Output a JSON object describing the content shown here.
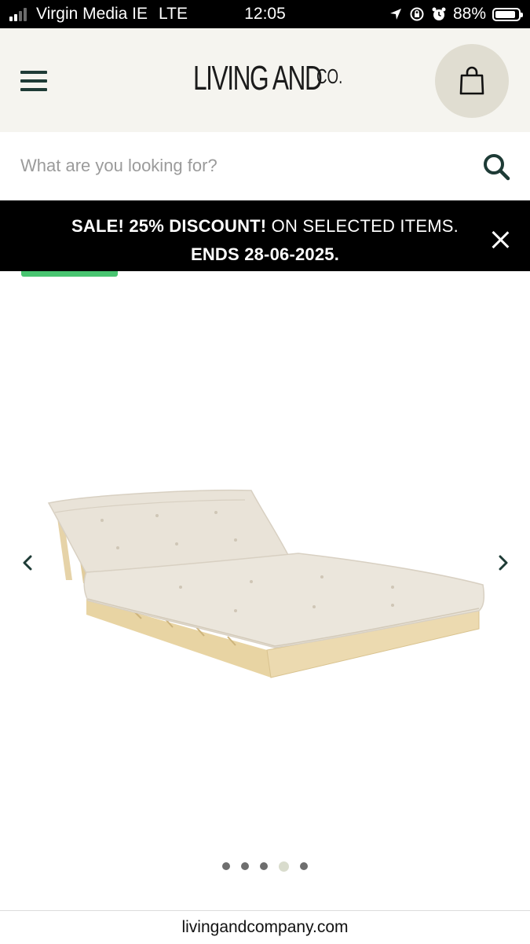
{
  "status_bar": {
    "carrier": "Virgin Media IE",
    "network": "LTE",
    "time": "12:05",
    "battery_percent_label": "88%",
    "battery_level": 0.88,
    "signal_bars": 2
  },
  "header": {
    "logo_main": "LIVING AND",
    "logo_suffix": "CO."
  },
  "search": {
    "placeholder": "What are you looking for?"
  },
  "promo": {
    "line1_bold": "SALE! 25% DISCOUNT!",
    "line1_rest": " ON SELECTED ITEMS.",
    "line2": "ENDS 28-06-2025."
  },
  "gallery": {
    "slide_count": 5,
    "active_slide": 4
  },
  "browser": {
    "url": "livingandcompany.com"
  },
  "colors": {
    "header_bg": "#f5f4ef",
    "cart_circle": "#e0ddd1",
    "icon_green": "#1e3b36",
    "badge_green": "#48c470",
    "promo_bg": "#000000"
  }
}
